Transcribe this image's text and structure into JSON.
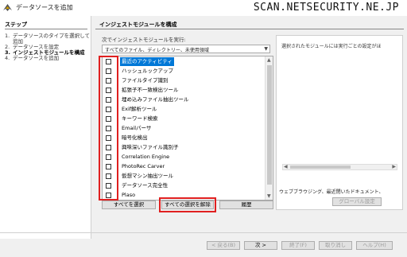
{
  "window": {
    "title": "データソースを追加"
  },
  "watermark": "SCAN.NETSECURITY.NE.JP",
  "steps": {
    "heading": "ステップ",
    "items": [
      {
        "num": "1.",
        "label": "データソースのタイプを選択して"
      },
      {
        "num": "",
        "label": "追加"
      },
      {
        "num": "2.",
        "label": "データソースを設定"
      },
      {
        "num": "3.",
        "label": "インジェストモジュールを構成"
      },
      {
        "num": "4.",
        "label": "データソースを追加"
      }
    ]
  },
  "page": {
    "title": "インジェストモジュールを構成",
    "run_label": "次でインジェストモジュールを実行:",
    "run_selected": "すべてのファイル、ディレクトリー、未使用領域"
  },
  "modules": [
    {
      "label": "最近のアクティビティ",
      "checked": false,
      "selected": true
    },
    {
      "label": "ハッシュルックアップ",
      "checked": false
    },
    {
      "label": "ファイルタイプ識別",
      "checked": false
    },
    {
      "label": "拡張子不一致検出ツール",
      "checked": false
    },
    {
      "label": "埋め込みファイル抽出ツール",
      "checked": false
    },
    {
      "label": "Exif解析ツール",
      "checked": false
    },
    {
      "label": "キーワード検索",
      "checked": false
    },
    {
      "label": "Emailパーサ",
      "checked": false
    },
    {
      "label": "暗号化検出",
      "checked": false
    },
    {
      "label": "興味深いファイル識別子",
      "checked": false
    },
    {
      "label": "Correlation Engine",
      "checked": false
    },
    {
      "label": "PhotoRec Carver",
      "checked": false
    },
    {
      "label": "仮想マシン抽出ツール",
      "checked": false
    },
    {
      "label": "データソース完全性",
      "checked": false
    },
    {
      "label": "Plaso",
      "checked": false
    }
  ],
  "list_buttons": {
    "select_all": "すべてを選択",
    "deselect_all": "すべての選択を解除",
    "history": "履歴"
  },
  "settings": {
    "placeholder": "選択されたモジュールには実行ごとの設定がほ",
    "description": "ウェブブラウジング、最近閉いたドキュメント、",
    "global_settings": "グローバル設定"
  },
  "nav": {
    "back": "< 戻る(B)",
    "next": "次 >",
    "finish": "終了(F)",
    "cancel": "取り消し",
    "help": "ヘルプ(H)"
  }
}
